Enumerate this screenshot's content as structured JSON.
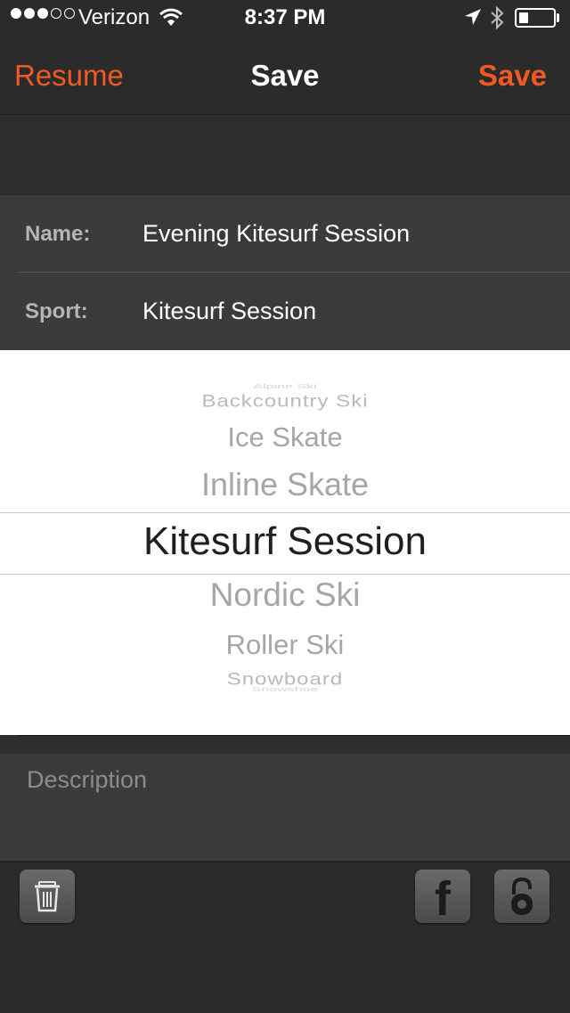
{
  "status_bar": {
    "carrier": "Verizon",
    "time": "8:37 PM",
    "signal_dots_filled": 3,
    "signal_dots_total": 5,
    "battery_fraction": 0.2
  },
  "nav": {
    "left_label": "Resume",
    "title": "Save",
    "right_label": "Save"
  },
  "form": {
    "name_label": "Name:",
    "name_value": "Evening Kitesurf Session",
    "sport_label": "Sport:",
    "sport_value": "Kitesurf Session"
  },
  "picker": {
    "items": [
      "Alpine Ski",
      "Backcountry Ski",
      "Ice Skate",
      "Inline Skate",
      "Kitesurf Session",
      "Nordic Ski",
      "Roller Ski",
      "Snowboard",
      "Snowshoe"
    ],
    "selected": "Kitesurf Session"
  },
  "description": {
    "placeholder": "Description"
  },
  "toolbar": {
    "facebook_glyph": "f",
    "icons": [
      "trash-icon",
      "facebook-icon",
      "lock-open-icon"
    ]
  },
  "colors": {
    "accent": "#f05a22",
    "background": "#2b2b2b",
    "row_background": "#3b3b3b",
    "picker_background": "#ffffff"
  }
}
